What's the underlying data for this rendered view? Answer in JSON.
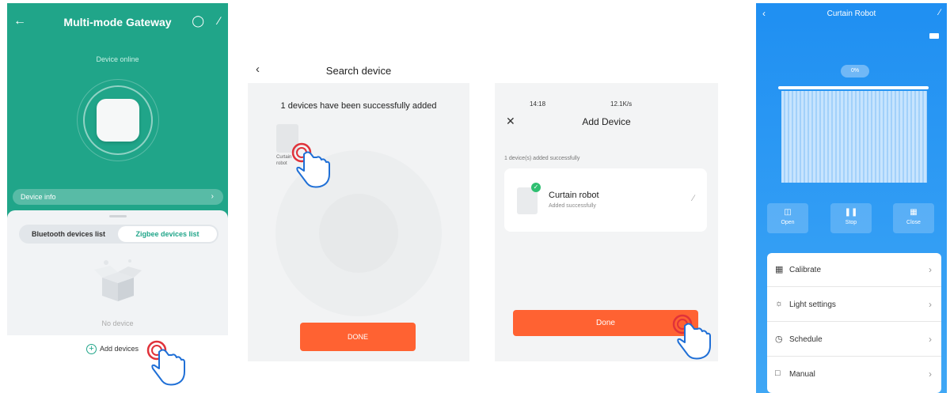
{
  "gateway": {
    "title": "Multi-mode Gateway",
    "status": "Device online",
    "device_info_label": "Device info",
    "tabs": [
      "Bluetooth devices list",
      "Zigbee devices list"
    ],
    "empty_text": "No device",
    "add_label": "Add devices",
    "accent": "#20a589"
  },
  "search": {
    "title": "Search device",
    "message": "1 devices have been successfully added",
    "device_label": "Curtain robot",
    "done_label": "DONE"
  },
  "add_device": {
    "status_time": "14:18",
    "status_right": "12.1K/s",
    "title": "Add Device",
    "added_count": "1 device(s) added successfully",
    "device_name": "Curtain robot",
    "device_status": "Added successfully",
    "done_label": "Done",
    "button_color": "#ff6232"
  },
  "curtain": {
    "title": "Curtain Robot",
    "percent": "0%",
    "controls": [
      {
        "label": "Open",
        "icon": "curtain-open-icon"
      },
      {
        "label": "Stop",
        "icon": "pause-icon"
      },
      {
        "label": "Close",
        "icon": "curtain-close-icon"
      }
    ],
    "menu": [
      {
        "label": "Calibrate",
        "icon": "calibrate-icon"
      },
      {
        "label": "Light settings",
        "icon": "sun-icon"
      },
      {
        "label": "Schedule",
        "icon": "clock-icon"
      },
      {
        "label": "Manual",
        "icon": "manual-icon"
      }
    ]
  }
}
